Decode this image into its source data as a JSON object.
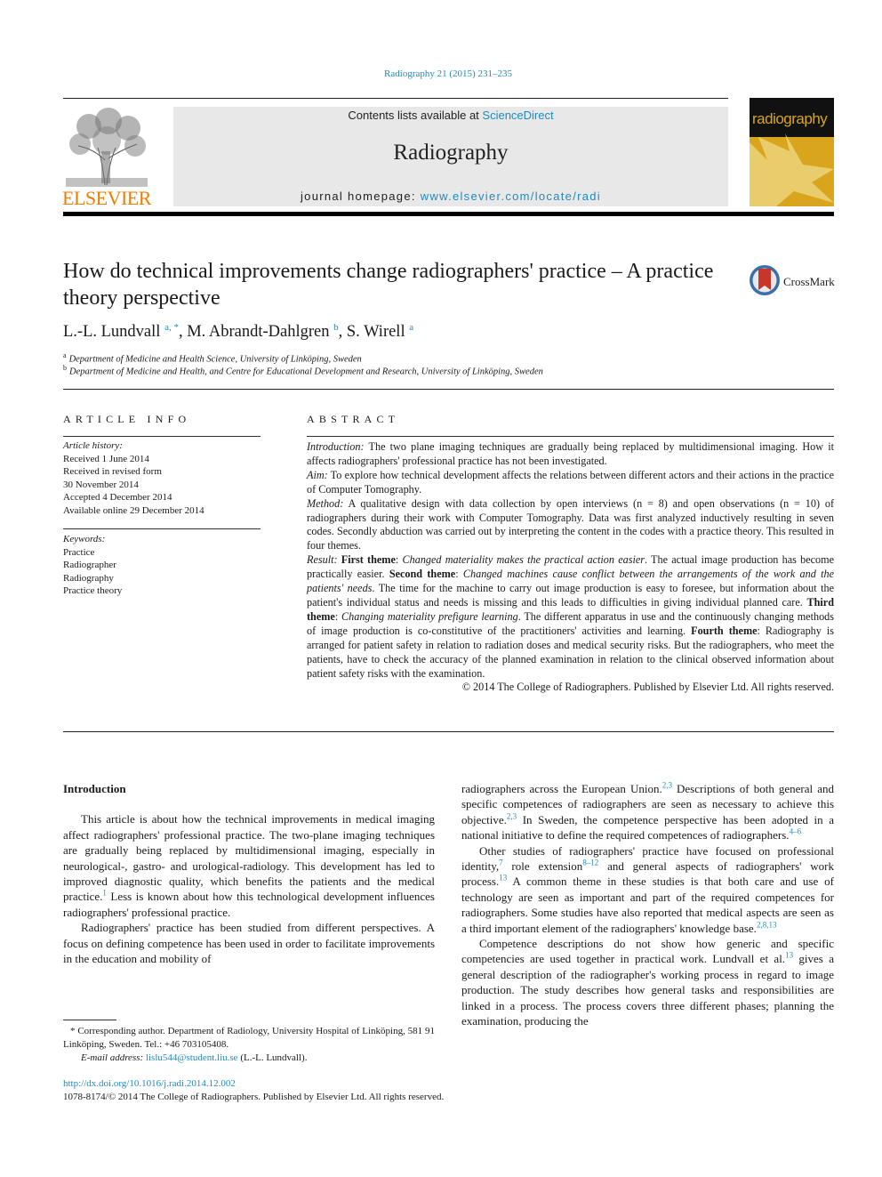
{
  "header": {
    "journal_ref": "Radiography 21 (2015) 231–235",
    "contents_prefix": "Contents lists available at ",
    "contents_link": "ScienceDirect",
    "journal_name": "Radiography",
    "homepage_prefix": "journal homepage: ",
    "homepage_link": "www.elsevier.com/locate/radi",
    "publisher_logo_text": "ELSEVIER",
    "cover_title": "radiography",
    "crossmark_label": "CrossMark"
  },
  "colors": {
    "link_blue": "#1e8bbf",
    "elsevier_orange": "#f07d00",
    "cover_gold": "#d8a51c",
    "masthead_gray": "#e8e8e8"
  },
  "article": {
    "title": "How do technical improvements change radiographers' practice – A practice theory perspective",
    "authors": [
      {
        "name": "L.-L. Lundvall",
        "sup": "a, *",
        "sep": ", "
      },
      {
        "name": "M. Abrandt-Dahlgren",
        "sup": "b",
        "sep": ", "
      },
      {
        "name": "S. Wirell",
        "sup": "a",
        "sep": ""
      }
    ],
    "affiliations": [
      {
        "key": "a",
        "text": "Department of Medicine and Health Science, University of Linköping, Sweden"
      },
      {
        "key": "b",
        "text": "Department of Medicine and Health, and Centre for Educational Development and Research, University of Linköping, Sweden"
      }
    ]
  },
  "article_info": {
    "heading": "ARTICLE INFO",
    "history_label": "Article history:",
    "history": [
      "Received 1 June 2014",
      "Received in revised form",
      "30 November 2014",
      "Accepted 4 December 2014",
      "Available online 29 December 2014"
    ],
    "keywords_label": "Keywords:",
    "keywords": [
      "Practice",
      "Radiographer",
      "Radiography",
      "Practice theory"
    ]
  },
  "abstract": {
    "heading": "ABSTRACT",
    "intro_label": "Introduction:",
    "intro_text": " The two plane imaging techniques are gradually being replaced by multidimensional imaging. How it affects radiographers' professional practice has not been investigated.",
    "aim_label": "Aim:",
    "aim_text": " To explore how technical development affects the relations between different actors and their actions in the practice of Computer Tomography.",
    "method_label": "Method:",
    "method_text": " A qualitative design with data collection by open interviews (n = 8) and open observations (n = 10) of radiographers during their work with Computer Tomography. Data was first analyzed inductively resulting in seven codes. Secondly abduction was carried out by interpreting the content in the codes with a practice theory. This resulted in four themes.",
    "result_label": "Result:",
    "theme1_label": "First theme",
    "theme1_title": "Changed materiality makes the practical action easier",
    "theme1_text": ". The actual image production has become practically easier. ",
    "theme2_label": "Second theme",
    "theme2_title": "Changed machines cause conflict between the arrangements of the work and the patients' needs",
    "theme2_text": ". The time for the machine to carry out image production is easy to foresee, but information about the patient's individual status and needs is missing and this leads to difficulties in giving individual planned care. ",
    "theme3_label": "Third theme",
    "theme3_title": "Changing materiality prefigure learning",
    "theme3_text": ". The different apparatus in use and the continuously changing methods of image production is co-constitutive of the practitioners' activities and learning. ",
    "theme4_label": "Fourth theme",
    "theme4_text": ": Radiography is arranged for patient safety in relation to radiation doses and medical security risks. But the radiographers, who meet the patients, have to check the accuracy of the planned examination in relation to the clinical observed information about patient safety risks with the examination.",
    "copyright": "© 2014 The College of Radiographers. Published by Elsevier Ltd. All rights reserved."
  },
  "body": {
    "section_title": "Introduction",
    "left_p1_a": "This article is about how the technical improvements in medical imaging affect radiographers' professional practice. The two-plane imaging techniques are gradually being replaced by multidimensional imaging, especially in neurological-, gastro- and urological-radiology. This development has led to improved diagnostic quality, which benefits the patients and the medical practice.",
    "left_p1_ref": "1",
    "left_p1_b": " Less is known about how this technological development influences radiographers' professional practice.",
    "left_p2": "Radiographers' practice has been studied from different perspectives. A focus on defining competence has been used in order to facilitate improvements in the education and mobility of",
    "right_p1_a": "radiographers across the European Union.",
    "right_p1_ref1": "2,3",
    "right_p1_b": " Descriptions of both general and specific competences of radiographers are seen as necessary to achieve this objective.",
    "right_p1_ref2": "2,3",
    "right_p1_c": " In Sweden, the competence perspective has been adopted in a national initiative to define the required competences of radiographers.",
    "right_p1_ref3": "4–6",
    "right_p2_a": "Other studies of radiographers' practice have focused on professional identity,",
    "right_p2_ref1": "7",
    "right_p2_b": " role extension",
    "right_p2_ref2": "8–12",
    "right_p2_c": " and general aspects of radiographers' work process.",
    "right_p2_ref3": "13",
    "right_p2_d": " A common theme in these studies is that both care and use of technology are seen as important and part of the required competences for radiographers. Some studies have also reported that medical aspects are seen as a third important element of the radiographers' knowledge base.",
    "right_p2_ref4": "2,8,13",
    "right_p3_a": "Competence descriptions do not show how generic and specific competencies are used together in practical work. Lundvall et al.",
    "right_p3_ref": "13",
    "right_p3_b": " gives a general description of the radiographer's working process in regard to image production. The study describes how general tasks and responsibilities are linked in a process. The process covers three different phases; planning the examination, producing the"
  },
  "footnote": {
    "star_text": "* Corresponding author. Department of Radiology, University Hospital of Linköping, 581 91 Linköping, Sweden. Tel.: +46 703105408.",
    "email_label": "E-mail address:",
    "email": "lislu544@student.liu.se",
    "email_suffix": " (L.-L. Lundvall)."
  },
  "footer": {
    "doi": "http://dx.doi.org/10.1016/j.radi.2014.12.002",
    "issn_copyright": "1078-8174/© 2014 The College of Radiographers. Published by Elsevier Ltd. All rights reserved."
  }
}
